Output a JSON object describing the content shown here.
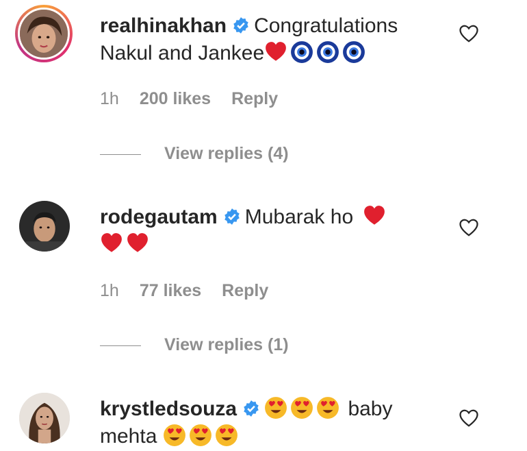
{
  "comments": [
    {
      "username": "realhinakhan",
      "text_a": "Congratulations",
      "text_b": "Nakul and Jankee",
      "emojis": [
        "red-heart",
        "nazar-amulet",
        "nazar-amulet",
        "nazar-amulet"
      ],
      "time": "1h",
      "likes": "200 likes",
      "reply": "Reply",
      "view_replies": "View replies (4)"
    },
    {
      "username": "rodegautam",
      "text_a": "Mubarak ho",
      "emojis": [
        "red-heart",
        "red-heart",
        "red-heart"
      ],
      "time": "1h",
      "likes": "77 likes",
      "reply": "Reply",
      "view_replies": "View replies (1)"
    },
    {
      "username": "krystledsouza",
      "text_a": "baby",
      "text_b": "mehta",
      "emojis": [
        "heart-eyes",
        "heart-eyes",
        "heart-eyes",
        "heart-eyes",
        "heart-eyes",
        "heart-eyes"
      ]
    }
  ],
  "colors": {
    "text": "#262626",
    "secondary": "#8e8e8e",
    "verified": "#3897f0",
    "heart": "#e0202e"
  }
}
